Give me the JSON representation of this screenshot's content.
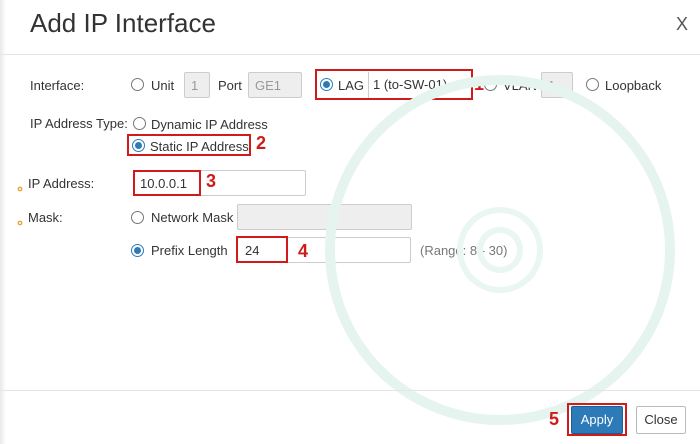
{
  "dialog": {
    "title": "Add IP Interface",
    "close_label": "X"
  },
  "interface": {
    "label": "Interface:",
    "unit_label": "Unit",
    "unit_value": "1",
    "port_label": "Port",
    "port_value": "GE1",
    "lag_label": "LAG",
    "lag_value": "1 (to-SW-01)",
    "vlan_label": "VLAN",
    "vlan_value": "1",
    "loopback_label": "Loopback",
    "selected": "LAG"
  },
  "ip_address_type": {
    "label": "IP Address Type:",
    "dynamic_label": "Dynamic IP Address",
    "static_label": "Static IP Address",
    "selected": "Static IP Address"
  },
  "ip_address": {
    "label": "IP Address:",
    "value": "10.0.0.1"
  },
  "mask": {
    "label": "Mask:",
    "network_mask_label": "Network Mask",
    "prefix_length_label": "Prefix Length",
    "prefix_value": "24",
    "range_text": "(Range: 8 - 30)",
    "selected": "Prefix Length"
  },
  "annotations": [
    "1",
    "2",
    "3",
    "4",
    "5"
  ],
  "buttons": {
    "apply_label": "Apply",
    "close_label": "Close"
  },
  "colors": {
    "accent": "#2c7ab8",
    "annotation_red": "#d11a1a",
    "required_icon": "#e8a33a"
  }
}
